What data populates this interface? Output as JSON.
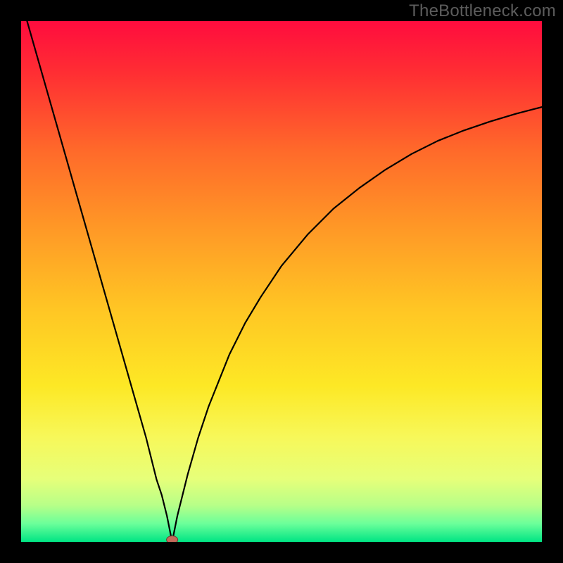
{
  "watermark": "TheBottleneck.com",
  "colors": {
    "frame": "#000000",
    "curve": "#000000",
    "marker_fill": "#c46a5a",
    "marker_stroke": "#6e3a31",
    "gradient_stops": [
      {
        "offset": 0.0,
        "color": "#ff0c3e"
      },
      {
        "offset": 0.1,
        "color": "#ff2e33"
      },
      {
        "offset": 0.25,
        "color": "#ff6a2a"
      },
      {
        "offset": 0.4,
        "color": "#ff9926"
      },
      {
        "offset": 0.55,
        "color": "#ffc524"
      },
      {
        "offset": 0.7,
        "color": "#fde825"
      },
      {
        "offset": 0.8,
        "color": "#f7f85a"
      },
      {
        "offset": 0.88,
        "color": "#e6ff7a"
      },
      {
        "offset": 0.93,
        "color": "#b7ff88"
      },
      {
        "offset": 0.965,
        "color": "#6bff9a"
      },
      {
        "offset": 1.0,
        "color": "#00e584"
      }
    ]
  },
  "chart_data": {
    "type": "line",
    "title": "",
    "xlabel": "",
    "ylabel": "",
    "xlim": [
      0,
      100
    ],
    "ylim": [
      0,
      100
    ],
    "grid": false,
    "legend": false,
    "marker": {
      "x": 29,
      "y": 0
    },
    "series": [
      {
        "name": "curve",
        "x": [
          0,
          2,
          4,
          6,
          8,
          10,
          12,
          14,
          16,
          18,
          20,
          22,
          24,
          26,
          27,
          28,
          29,
          30,
          31,
          32,
          34,
          36,
          38,
          40,
          43,
          46,
          50,
          55,
          60,
          65,
          70,
          75,
          80,
          85,
          90,
          95,
          100
        ],
        "y": [
          104,
          97,
          90,
          83,
          76,
          69,
          62,
          55,
          48,
          41,
          34,
          27,
          20,
          12,
          9,
          5,
          0,
          5,
          9,
          13,
          20,
          26,
          31,
          36,
          42,
          47,
          53,
          59,
          64,
          68,
          71.5,
          74.5,
          77,
          79,
          80.7,
          82.2,
          83.5
        ]
      }
    ]
  }
}
